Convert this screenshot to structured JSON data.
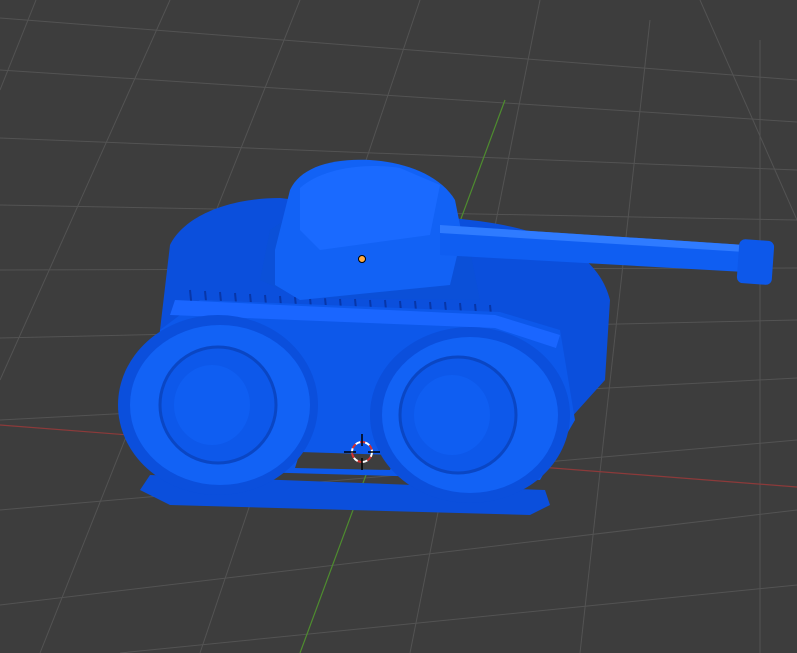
{
  "viewport": {
    "background_color": "#3d3d3d",
    "grid_line_color": "#4f4f4f",
    "x_axis_color": "#8c3a3a",
    "y_axis_color": "#4e8c2f"
  },
  "object": {
    "name": "tank",
    "color": "#0f5ef2",
    "highlight_color": "#2f7bff",
    "shadow_color": "#0a46c4",
    "origin_dot_color": "#ffaa40"
  },
  "cursor": {
    "icon": "3d-cursor-icon",
    "ring_color_a": "#ffffff",
    "ring_color_b": "#d83030",
    "crosshair_color": "#000000"
  }
}
